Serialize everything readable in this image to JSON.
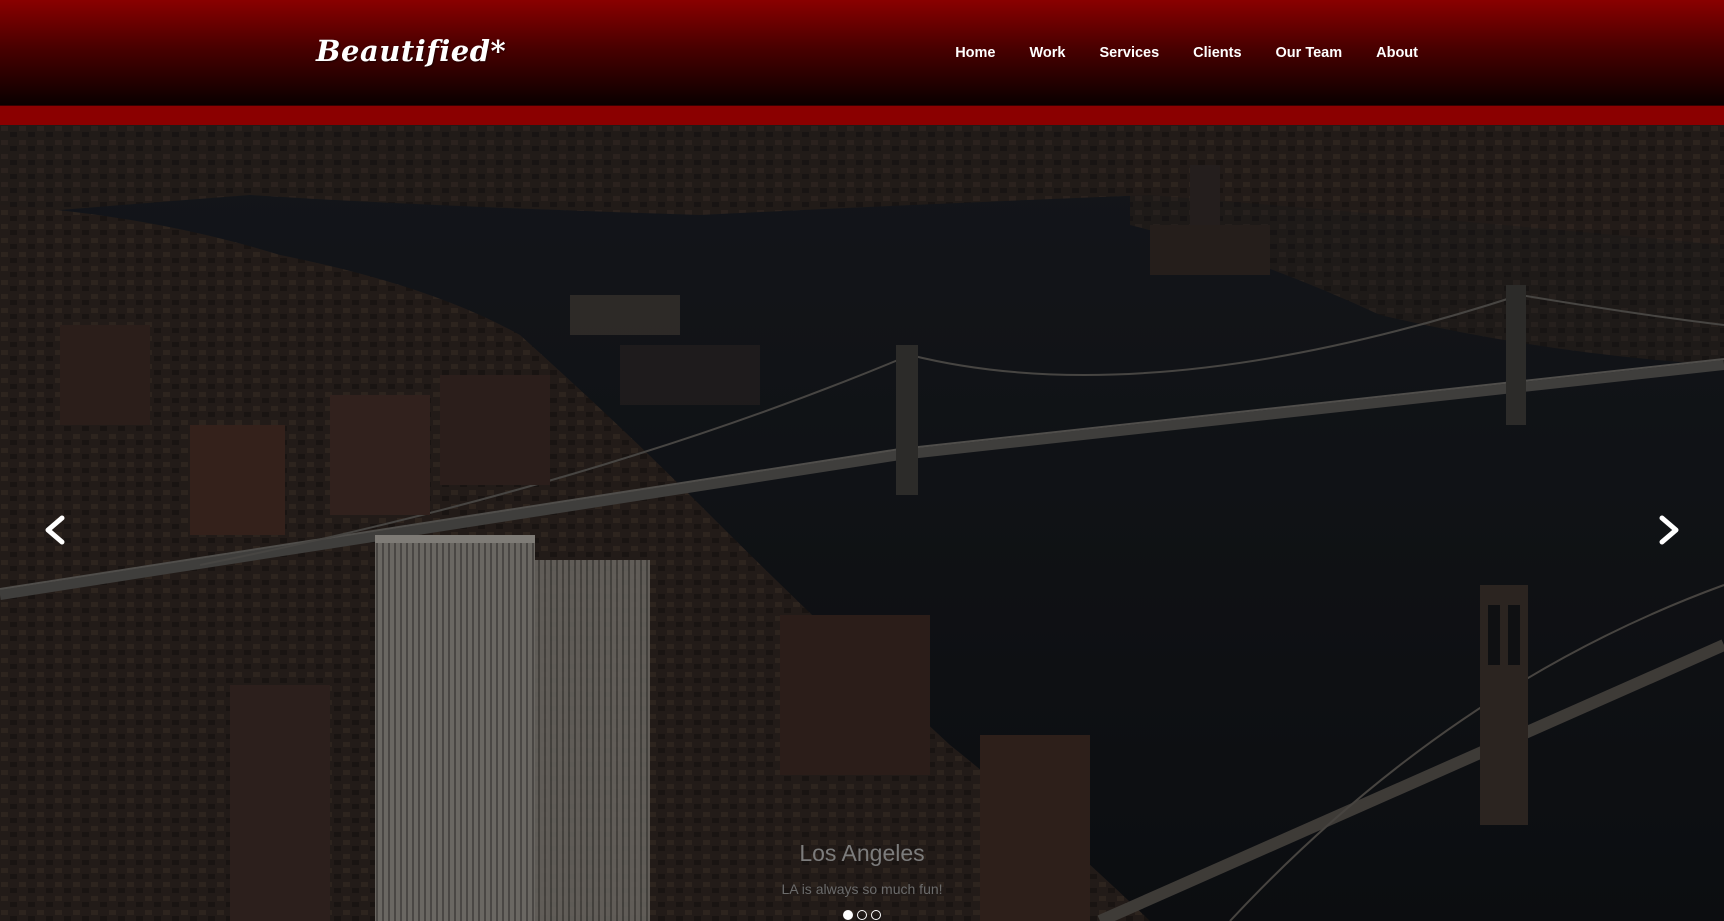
{
  "header": {
    "logo": "Beautified*",
    "nav": [
      "Home",
      "Work",
      "Services",
      "Clients",
      "Our Team",
      "About"
    ]
  },
  "hero": {
    "slide_title": "Los Angeles",
    "slide_subtitle": "LA is always so much fun!",
    "slide_count": 3,
    "active_slide": 1
  },
  "colors": {
    "header_top": "#8a0000",
    "header_stripe": "#8b0000",
    "text": "#ffffff"
  },
  "icons": [
    "chevron-left-icon",
    "chevron-right-icon"
  ]
}
